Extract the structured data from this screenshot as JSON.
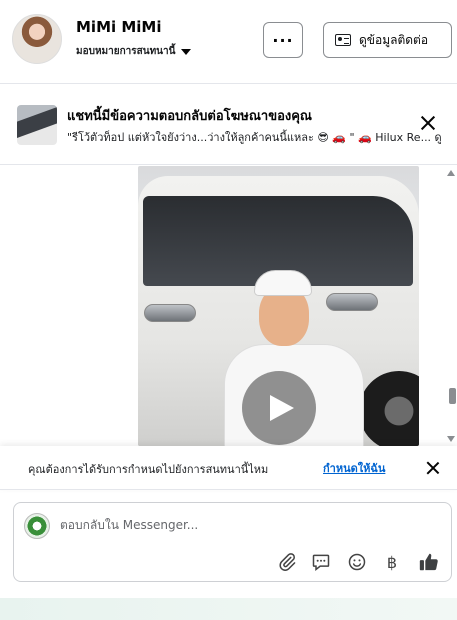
{
  "header": {
    "contact_name": "MiMi MiMi",
    "assign_label": "มอบหมายการสนทนานี้",
    "more_label": "···",
    "contact_info_label": "ดูข้อมูลติดต่อ"
  },
  "ad_banner": {
    "title": "แชทนี้มีข้อความตอบกลับต่อโฆษณาของคุณ",
    "snippet": "\"รีโว้ตัวท็อป แต่หัวใจยังว่าง...ว่างให้ลูกค้าคนนี้แหละ 😎 🚗 \" 🚗 Hilux Re... ดู"
  },
  "assign_prompt": {
    "text": "คุณต้องการได้รับการกำหนดไปยังการสนทนานี้ไหม",
    "link": "กำหนดให้ฉัน"
  },
  "composer": {
    "placeholder": "ตอบกลับใน Messenger...",
    "currency_symbol": "฿"
  }
}
